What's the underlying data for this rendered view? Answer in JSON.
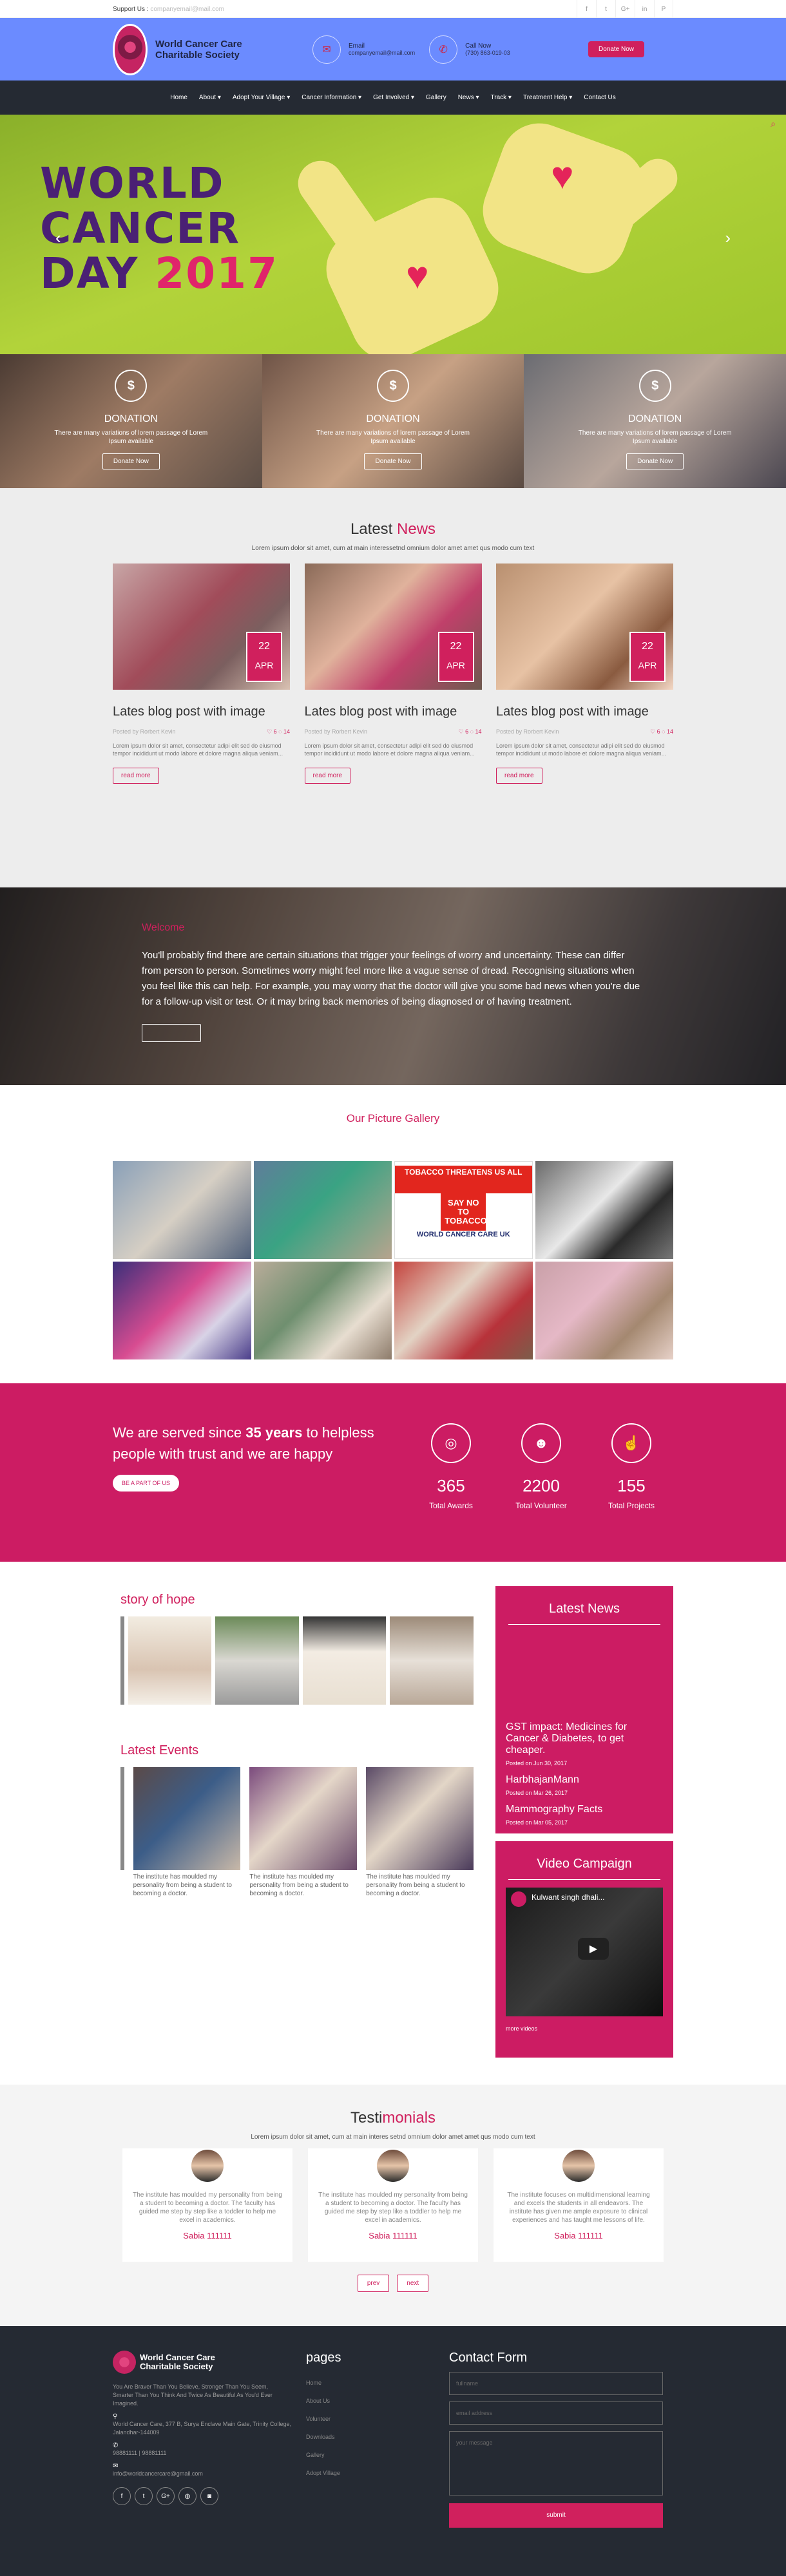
{
  "topbar": {
    "support_label": "Support Us :",
    "support_email": "companyemail@mail.com",
    "socials": [
      {
        "icon": "facebook-icon",
        "glyph": "f"
      },
      {
        "icon": "twitter-icon",
        "glyph": "t"
      },
      {
        "icon": "google-plus-icon",
        "glyph": "G+"
      },
      {
        "icon": "linkedin-icon",
        "glyph": "in"
      },
      {
        "icon": "pinterest-icon",
        "glyph": "P"
      }
    ]
  },
  "header": {
    "logo_line1": "World Cancer Care",
    "logo_line2": "Charitable Society",
    "email_label": "Email",
    "email_value": "companyemail@mail.com",
    "call_label": "Call Now",
    "call_value": "(730) 863-019-03",
    "donate_label": "Donate Now"
  },
  "nav": [
    "Home",
    "About ▾",
    "Adopt Your Village ▾",
    "Cancer Information ▾",
    "Get Involved ▾",
    "Gallery",
    "News ▾",
    "Track ▾",
    "Treatment Help ▾",
    "Contact Us"
  ],
  "hero": {
    "line1": "WORLD",
    "line2": "CANCER",
    "line3": "DAY",
    "year": "2017"
  },
  "donations": [
    {
      "title": "DONATION",
      "text": "There are many variations of lorem passage of Lorem Ipsum available",
      "button": "Donate Now"
    },
    {
      "title": "DONATION",
      "text": "There are many variations of lorem passage of Lorem Ipsum available",
      "button": "Donate Now"
    },
    {
      "title": "DONATION",
      "text": "There are many variations of lorem passage of Lorem Ipsum available",
      "button": "Donate Now"
    }
  ],
  "latest_news": {
    "title_plain": "Latest",
    "title_accent": "News",
    "subtitle": "Lorem ipsum dolor sit amet, cum at main interessetnd omnium dolor amet amet qus modo cum text",
    "cards": [
      {
        "day": "22",
        "month": "APR",
        "title": "Lates blog post with image",
        "author": "Posted by Rorbert Kevin",
        "comments": "♡ 6 ◌ 14",
        "excerpt": "Lorem ipsum dolor sit amet, consectetur adipi elit sed do eiusmod tempor incididunt ut modo labore et dolore magna aliqua veniam...",
        "button": "read more"
      },
      {
        "day": "22",
        "month": "APR",
        "title": "Lates blog post with image",
        "author": "Posted by Rorbert Kevin",
        "comments": "♡ 6 ◌ 14",
        "excerpt": "Lorem ipsum dolor sit amet, consectetur adipi elit sed do eiusmod tempor incididunt ut modo labore et dolore magna aliqua veniam...",
        "button": "read more"
      },
      {
        "day": "22",
        "month": "APR",
        "title": "Lates blog post with image",
        "author": "Posted by Rorbert Kevin",
        "comments": "♡ 6 ◌ 14",
        "excerpt": "Lorem ipsum dolor sit amet, consectetur adipi elit sed do eiusmod tempor incididunt ut modo labore et dolore magna aliqua veniam...",
        "button": "read more"
      }
    ]
  },
  "quote": {
    "title": "Welcome",
    "text": "You'll probably find there are certain situations that trigger your feelings of worry and uncertainty. These can differ from person to person. Sometimes worry might feel more like a vague sense of dread. Recognising situations when you feel like this can help. For example, you may worry that the doctor will give you some bad news when you're due for a follow-up visit or test. Or it may bring back memories of being diagnosed or of having treatment."
  },
  "gallery": {
    "title": "Our Picture Gallery",
    "poster_top": "TOBACCO THREATENS US ALL",
    "poster_no": "SAY NO TO TOBACCO",
    "poster_org": "WORLD CANCER CARE UK"
  },
  "stats": {
    "headline_a": "We are served since ",
    "headline_b": "35 years",
    "headline_c": " to helpless people with trust and we are happy",
    "button": "BE A PART OF US",
    "items": [
      {
        "icon": "chrome-award-icon",
        "glyph": "◎",
        "value": "365",
        "label": "Total Awards"
      },
      {
        "icon": "users-icon",
        "glyph": "☻",
        "value": "2200",
        "label": "Total Volunteer"
      },
      {
        "icon": "thumbs-up-icon",
        "glyph": "☝",
        "value": "155",
        "label": "Total Projects"
      }
    ]
  },
  "story": {
    "hope_title": "story of hope",
    "events_title": "Latest Events",
    "events": [
      {
        "caption": "The institute has moulded my personality from being a student to becoming a doctor."
      },
      {
        "caption": "The institute has moulded my personality from being a student to becoming a doctor."
      },
      {
        "caption": "The institute has moulded my personality from being a student to becoming a doctor."
      }
    ]
  },
  "sidebar_news": {
    "title": "Latest News",
    "items": [
      {
        "title": "GST impact: Medicines for Cancer & Diabetes, to get cheaper.",
        "posted": "Posted on Jun 30, 2017"
      },
      {
        "title": "HarbhajanMann",
        "posted": "Posted on Mar 26, 2017"
      },
      {
        "title": "Mammography Facts",
        "posted": "Posted on Mar 05, 2017"
      }
    ]
  },
  "video": {
    "title": "Video Campaign",
    "video_title": "Kulwant singh dhali...",
    "more": "more videos"
  },
  "testimonials": {
    "title_plain": "Testi",
    "title_accent": "monials",
    "subtitle": "Lorem ipsum dolor sit amet, cum at main interes setnd omnium dolor amet amet qus modo cum text",
    "items": [
      {
        "text": "The institute has moulded my personality from being a student to becoming a doctor. The faculty has guided me step by step like a toddler to help me excel in academics.",
        "name": "Sabia 111111"
      },
      {
        "text": "The institute has moulded my personality from being a student to becoming a doctor. The faculty has guided me step by step like a toddler to help me excel in academics.",
        "name": "Sabia 111111"
      },
      {
        "text": "The institute focuses on multidimensional learning and excels the students in all endeavors. The institute has given me ample exposure to clinical experiences and has taught me lessons of life.",
        "name": "Sabia 111111"
      }
    ],
    "prev": "prev",
    "next": "next"
  },
  "footer": {
    "logo_line1": "World Cancer Care",
    "logo_line2": "Charitable Society",
    "desc": "You Are Braver Than You Believe, Stronger Than You Seem, Smarter Than You Think And Twice As Beautiful As You'd Ever Imagined.",
    "address": "World Cancer Care, 377 B, Surya Enclave Main Gate, Trinity College, Jalandhar-144009",
    "phone": "98881111 | 98881111",
    "email": "info@worldcancercare@gmail.com",
    "pages_title": "pages",
    "pages": [
      "Home",
      "About Us",
      "Volunteer",
      "Downloads",
      "Gallery",
      "Adopt Village"
    ],
    "contact_title": "Contact Form",
    "name_placeholder": "fullname",
    "email_placeholder": "email address",
    "message_placeholder": "your message",
    "submit": "submit",
    "socials": [
      {
        "icon": "facebook-icon",
        "glyph": "f"
      },
      {
        "icon": "twitter-icon",
        "glyph": "t"
      },
      {
        "icon": "google-plus-icon",
        "glyph": "G+"
      },
      {
        "icon": "dribbble-icon",
        "glyph": "◍"
      },
      {
        "icon": "instagram-icon",
        "glyph": "◙"
      }
    ]
  }
}
